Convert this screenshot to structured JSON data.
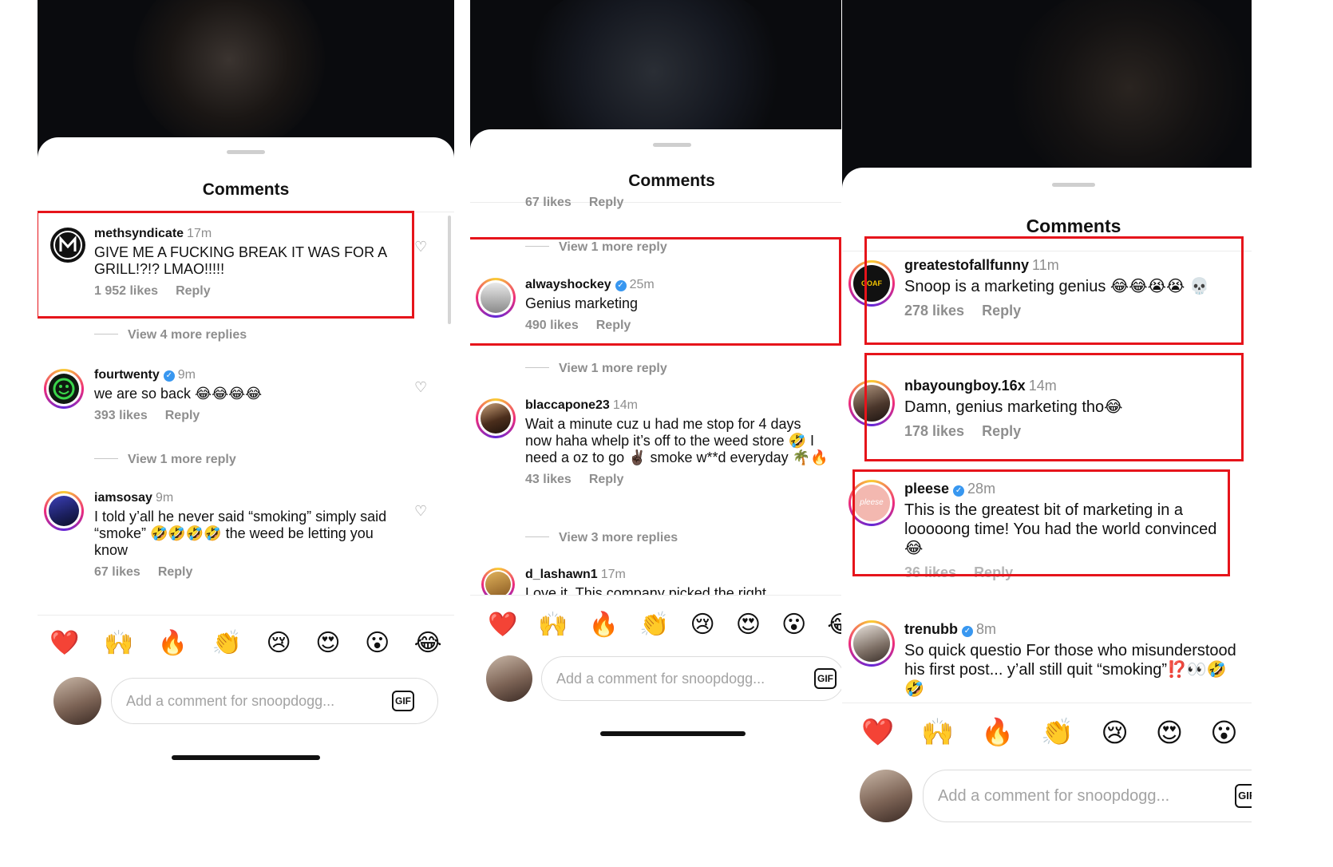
{
  "sheet_title": "Comments",
  "input_placeholder": "Add a comment for snoopdogg...",
  "gif_label": "GIF",
  "emojis": [
    "❤️",
    "🙌",
    "🔥",
    "👏",
    "😢",
    "😍",
    "😮",
    "😂"
  ],
  "colors": {
    "highlight": "#e6141b",
    "verified": "#3897f0",
    "muted": "#8e8e8e"
  },
  "panel1": {
    "comments": [
      {
        "username": "methsyndicate",
        "verified": false,
        "time": "17m",
        "text": "GIVE ME A FUCKING BREAK IT WAS FOR A GRILL!?!? LMAO!!!!!",
        "likes": "1 952 likes",
        "reply": "Reply"
      },
      {
        "username": "fourtwenty",
        "verified": true,
        "time": "9m",
        "text": "we are so back 😂😂😂😂",
        "likes": "393 likes",
        "reply": "Reply"
      },
      {
        "username": "iamsosay",
        "verified": false,
        "time": "9m",
        "text": "I told y’all he never said “smoking” simply said “smoke” 🤣🤣🤣🤣 the weed be letting you know",
        "likes": "67 likes",
        "reply": "Reply"
      }
    ],
    "view_more": [
      "View 4 more replies",
      "View 1 more reply"
    ]
  },
  "panel2": {
    "top_meta": {
      "likes": "67 likes",
      "reply": "Reply"
    },
    "view_more": [
      "View 1 more reply",
      "View 1 more reply",
      "View 3 more replies"
    ],
    "comments": [
      {
        "username": "alwayshockey",
        "verified": true,
        "time": "25m",
        "text": "Genius marketing",
        "likes": "490 likes",
        "reply": "Reply"
      },
      {
        "username": "blaccapone23",
        "verified": false,
        "time": "14m",
        "text": "Wait a minute cuz u had me stop for 4 days now haha whelp it’s off to the weed store 🤣 I need a oz to go ✌🏿 smoke w**d everyday 🌴🔥",
        "likes": "43 likes",
        "reply": "Reply"
      },
      {
        "username": "d_lashawn1",
        "verified": false,
        "time": "17m",
        "text": "Love it. This company picked the right",
        "likes": "",
        "reply": ""
      }
    ]
  },
  "panel3": {
    "comments": [
      {
        "username": "greatestofallfunny",
        "verified": false,
        "time": "11m",
        "text": "Snoop is a marketing genius 😂😂😭😭 💀",
        "likes": "278 likes",
        "reply": "Reply"
      },
      {
        "username": "nbayoungboy.16x",
        "verified": false,
        "time": "14m",
        "text": "Damn, genius marketing tho😂",
        "likes": "178 likes",
        "reply": "Reply"
      },
      {
        "username": "pleese",
        "verified": true,
        "time": "28m",
        "text": "This is the greatest bit of marketing in a looooong time! You had the world convinced 😂",
        "likes": "36 likes",
        "reply": "Reply"
      },
      {
        "username": "trenubb",
        "verified": true,
        "time": "8m",
        "text": "So quick questio For those who misunderstood his first post... y’all still quit “smoking”⁉️👀🤣🤣",
        "likes": "",
        "reply": ""
      }
    ],
    "avatar_label": "GOAF",
    "pleese_logo": "pleese"
  }
}
